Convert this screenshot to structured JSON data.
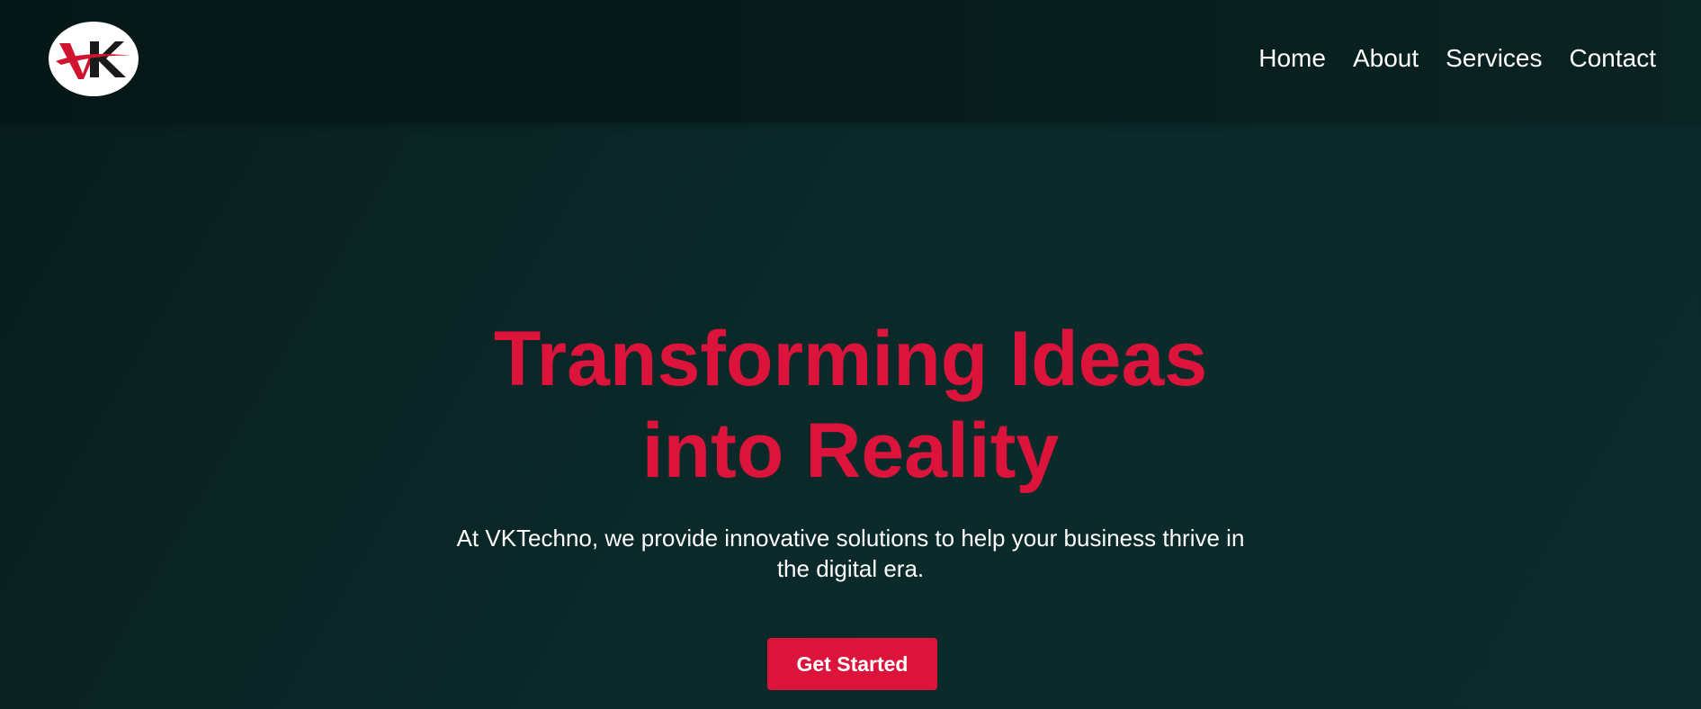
{
  "brand": {
    "logo_text": "VK",
    "logo_icon": "vk-logo-icon",
    "colors": {
      "accent": "#dc143c",
      "background": "#0b2929",
      "nav_background": "#061717",
      "text": "#ffffff"
    }
  },
  "nav": {
    "items": [
      {
        "label": "Home"
      },
      {
        "label": "About"
      },
      {
        "label": "Services"
      },
      {
        "label": "Contact"
      }
    ]
  },
  "hero": {
    "title": "Transforming Ideas into Reality",
    "subtitle": "At VKTechno, we provide innovative solutions to help your business thrive in the digital era.",
    "cta_label": "Get Started"
  }
}
